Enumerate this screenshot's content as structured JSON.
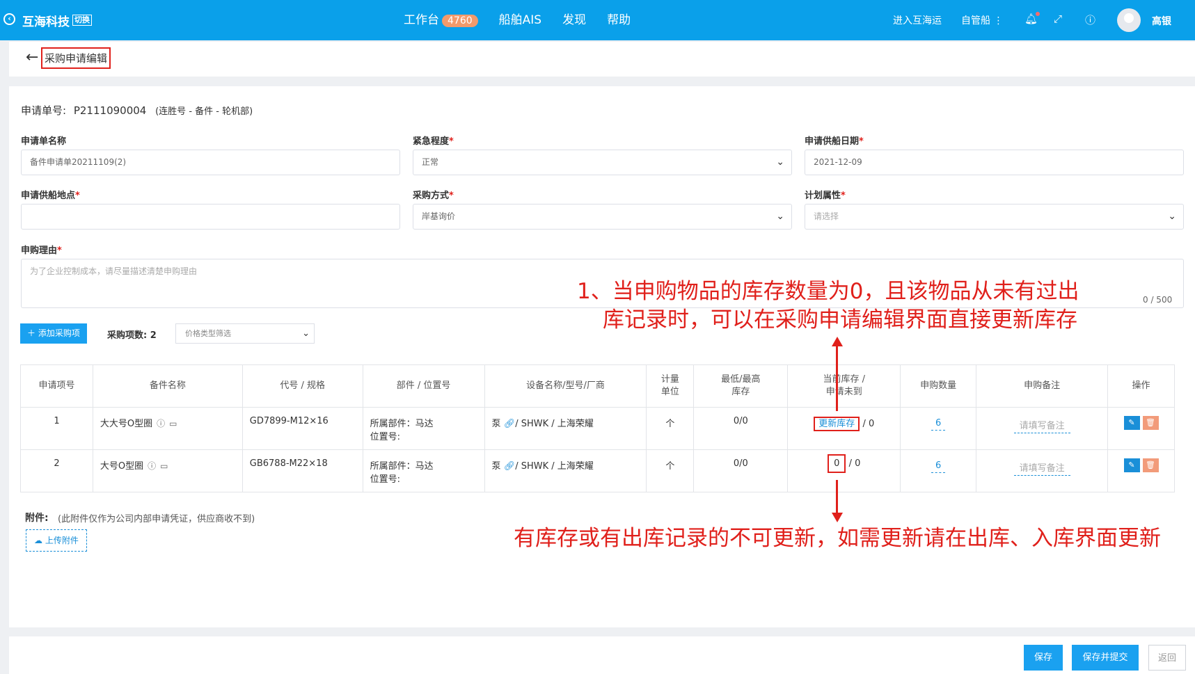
{
  "topbar": {
    "brand": "互海科技",
    "switch_label": "切换",
    "nav": [
      {
        "label": "工作台",
        "badge": "4760"
      },
      {
        "label": "船舶AIS"
      },
      {
        "label": "发现"
      },
      {
        "label": "帮助"
      }
    ],
    "right_links": [
      "进入互海运",
      "自管船 ⋮"
    ],
    "user_name": "高银"
  },
  "header": {
    "page_title": "采购申请编辑"
  },
  "form": {
    "request_no_label": "申请单号:",
    "request_no": "P2111090004",
    "request_meta": "(连胜号 - 备件 - 轮机部)",
    "name_label": "申请单名称",
    "name_value": "备件申请单20211109(2)",
    "urgency_label": "紧急程度",
    "urgency_value": "正常",
    "supply_date_label": "申请供船日期",
    "supply_date_value": "2021-12-09",
    "supply_place_label": "申请供船地点",
    "supply_place_value": "",
    "purchase_method_label": "采购方式",
    "purchase_method_value": "岸基询价",
    "plan_attr_label": "计划属性",
    "plan_attr_placeholder": "请选择",
    "reason_label": "申购理由",
    "reason_placeholder": "为了企业控制成本，请尽量描述清楚申购理由",
    "reason_counter": "0 / 500",
    "required_mark": "*"
  },
  "toolbar": {
    "add_button": "＋ 添加采购项",
    "count_label": "采购项数:",
    "count_value": "2",
    "filter_placeholder": "价格类型筛选"
  },
  "table": {
    "headers": [
      "申请项号",
      "备件名称",
      "代号 / 规格",
      "部件 / 位置号",
      "设备名称/型号/厂商",
      "计量单位",
      "最低/最高库存",
      "当前库存 / 申请未到",
      "申购数量",
      "申购备注",
      "操作"
    ],
    "rows": [
      {
        "no": "1",
        "name": "大大号O型圈",
        "spec": "GD7899-M12×16",
        "part": "所属部件：马达",
        "position": "位置号:",
        "equipment_prefix": "泵",
        "equipment": "/ SHWK / 上海荣耀",
        "unit": "个",
        "min_max": "0/0",
        "stock": "更新库存",
        "pending": "/ 0",
        "qty": "6",
        "remark_placeholder": "请填写备注"
      },
      {
        "no": "2",
        "name": "大号O型圈",
        "spec": "GB6788-M22×18",
        "part": "所属部件：马达",
        "position": "位置号:",
        "equipment_prefix": "泵",
        "equipment": "/ SHWK / 上海荣耀",
        "unit": "个",
        "min_max": "0/0",
        "stock": "0",
        "pending": "/ 0",
        "qty": "6",
        "remark_placeholder": "请填写备注"
      }
    ]
  },
  "attachments": {
    "title": "附件:",
    "note": "(此附件仅作为公司内部申请凭证，供应商收不到)",
    "upload_button": "上传附件"
  },
  "annotations": {
    "line1": "1、当申购物品的库存数量为0，且该物品从未有过出",
    "line2": "库记录时，可以在采购申请编辑界面直接更新库存",
    "line3": "有库存或有出库记录的不可更新，如需更新请在出库、入库界面更新"
  },
  "footer": {
    "save": "保存",
    "save_submit": "保存并提交",
    "back": "返回"
  }
}
